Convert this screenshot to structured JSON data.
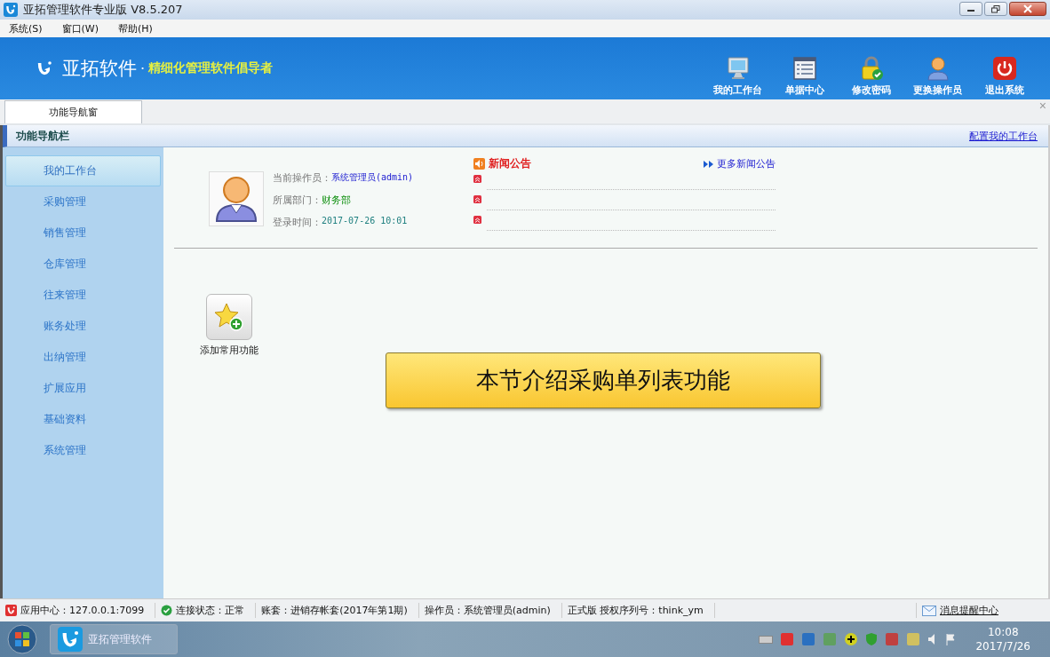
{
  "window": {
    "title": "亚拓管理软件专业版 V8.5.207"
  },
  "menu": [
    {
      "label": "系统(S)"
    },
    {
      "label": "窗口(W)"
    },
    {
      "label": "帮助(H)"
    }
  ],
  "banner": {
    "brand": "亚拓软件",
    "separator": "·",
    "slogan": "精细化管理软件倡导者",
    "buttons": [
      {
        "label": "我的工作台",
        "kind": "monitor"
      },
      {
        "label": "单据中心",
        "kind": "list"
      },
      {
        "label": "修改密码",
        "kind": "lock"
      },
      {
        "label": "更换操作员",
        "kind": "user"
      },
      {
        "label": "退出系统",
        "kind": "power"
      }
    ]
  },
  "tabs": [
    {
      "label": "功能导航窗",
      "selected": true
    }
  ],
  "tab_close": "×",
  "nav": {
    "title": "功能导航栏",
    "config_link": "配置我的工作台",
    "items": [
      {
        "label": "我的工作台",
        "selected": true
      },
      {
        "label": "采购管理",
        "selected": false
      },
      {
        "label": "销售管理",
        "selected": false
      },
      {
        "label": "仓库管理",
        "selected": false
      },
      {
        "label": "往来管理",
        "selected": false
      },
      {
        "label": "账务处理",
        "selected": false
      },
      {
        "label": "出纳管理",
        "selected": false
      },
      {
        "label": "扩展应用",
        "selected": false
      },
      {
        "label": "基础资料",
        "selected": false
      },
      {
        "label": "系统管理",
        "selected": false
      }
    ]
  },
  "profile": {
    "fields": [
      {
        "label": "当前操作员：",
        "value": "系统管理员(admin)",
        "kind": "operator"
      },
      {
        "label": "所属部门：",
        "value": "财务部",
        "kind": "department"
      },
      {
        "label": "登录时间：",
        "value": "2017-07-26 10:01",
        "kind": "time"
      }
    ]
  },
  "news": {
    "title": "新闻公告",
    "more": "更多新闻公告"
  },
  "shortcuts": [
    {
      "label": "添加常用功能"
    }
  ],
  "caption": "本节介绍采购单列表功能",
  "status_bar": [
    {
      "kind": "app",
      "text": "应用中心：127.0.0.1:7099"
    },
    {
      "kind": "ok",
      "text": "连接状态：正常"
    },
    {
      "kind": "plain",
      "text": "账套：进销存帐套(2017年第1期)"
    },
    {
      "kind": "plain",
      "text": "操作员：系统管理员(admin)"
    },
    {
      "kind": "plain",
      "text": "正式版 授权序列号：think_ym"
    },
    {
      "kind": "mail",
      "text": "消息提醒中心"
    }
  ],
  "taskbar": {
    "app": "亚拓管理软件",
    "time": "10:08",
    "date": "2017/7/26"
  }
}
